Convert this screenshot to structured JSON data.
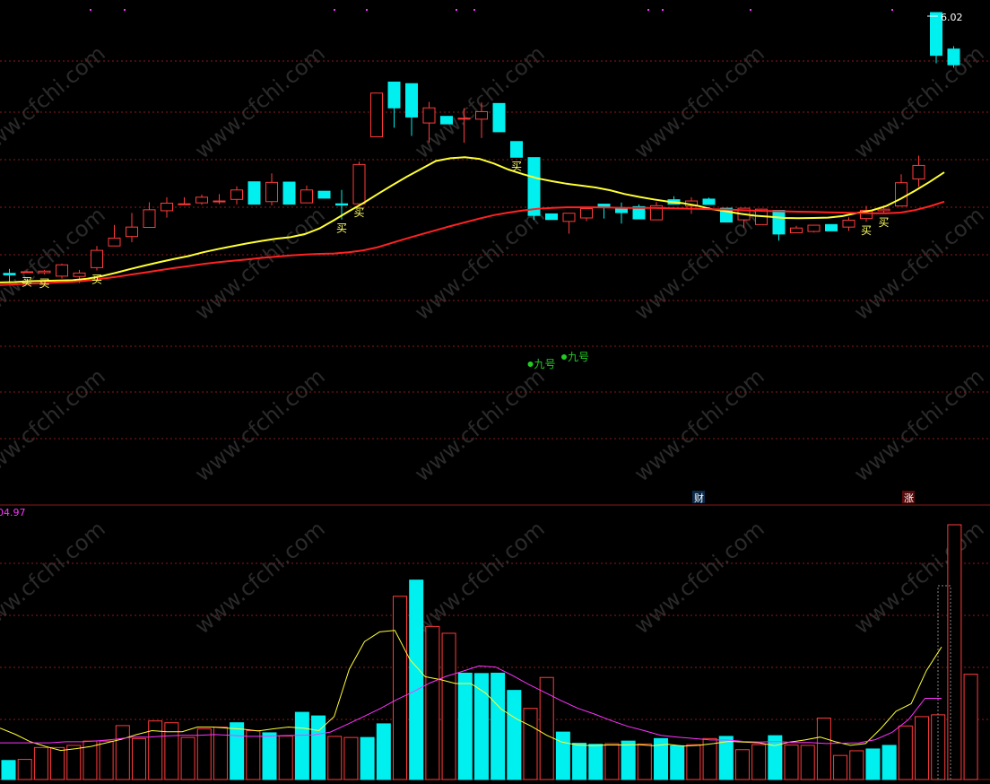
{
  "colors": {
    "background": "#000000",
    "up": "#ff3b3b",
    "down": "#00f0f0",
    "ma_short": "#ffff33",
    "ma_long": "#ff2222",
    "vol_ma_short": "#ffff33",
    "vol_ma_long": "#ff33ff",
    "grid": "#8b1a1a",
    "buy_signal": "#ffff66",
    "nine_signal": "#22cc22",
    "value_label": "#ff33ff",
    "price_label": "#ffffff",
    "watermark": "#2a2a2a"
  },
  "price_panel": {
    "high_price_label": "6.02",
    "buy_label": "买",
    "nine_label": "九号",
    "tags": {
      "cai": "财",
      "zhang": "涨"
    }
  },
  "volume_panel": {
    "max_label": "04.97"
  },
  "watermark": "www.cfchi.com",
  "chart_data": [
    {
      "type": "candlestick",
      "title": "",
      "price_range": [
        0,
        100
      ],
      "candles": [
        {
          "o": 67.1,
          "c": 66.6,
          "h": 68.5,
          "l": 64.0
        },
        {
          "o": 67.6,
          "c": 67.6,
          "h": 68.0,
          "l": 67.2
        },
        {
          "o": 67.3,
          "c": 67.8,
          "h": 68.2,
          "l": 66.8
        },
        {
          "o": 66.2,
          "c": 69.8,
          "h": 70.2,
          "l": 65.4
        },
        {
          "o": 66.1,
          "c": 67.2,
          "h": 68.2,
          "l": 64.0
        },
        {
          "o": 68.9,
          "c": 74.4,
          "h": 75.8,
          "l": 68.0
        },
        {
          "o": 75.8,
          "c": 78.3,
          "h": 82.5,
          "l": 75.8
        },
        {
          "o": 78.8,
          "c": 81.8,
          "h": 86.3,
          "l": 77.0
        },
        {
          "o": 81.7,
          "c": 87.3,
          "h": 89.7,
          "l": 81.7
        },
        {
          "o": 87.0,
          "c": 89.4,
          "h": 91.3,
          "l": 84.8
        },
        {
          "o": 89.2,
          "c": 89.2,
          "h": 91.3,
          "l": 89.2
        },
        {
          "o": 89.5,
          "c": 91.3,
          "h": 92.1,
          "l": 88.9
        },
        {
          "o": 90.1,
          "c": 90.1,
          "h": 92.3,
          "l": 89.1
        },
        {
          "o": 90.6,
          "c": 93.6,
          "h": 94.8,
          "l": 89.0
        },
        {
          "o": 96.2,
          "c": 89.1,
          "h": 96.2,
          "l": 89.1
        },
        {
          "o": 89.9,
          "c": 96.0,
          "h": 98.9,
          "l": 88.7
        },
        {
          "o": 96.1,
          "c": 89.1,
          "h": 96.1,
          "l": 89.1
        },
        {
          "o": 89.5,
          "c": 93.6,
          "h": 95.0,
          "l": 89.4
        },
        {
          "o": 93.2,
          "c": 91.0,
          "h": 93.2,
          "l": 91.0
        },
        {
          "o": 89.2,
          "c": 88.8,
          "h": 93.6,
          "l": 84.2
        },
        {
          "o": 89.2,
          "c": 101.7,
          "h": 102.6,
          "l": 89.2
        },
        {
          "o": 110.5,
          "c": 124.4,
          "h": 124.4,
          "l": 110.4
        },
        {
          "o": 127.9,
          "c": 119.7,
          "h": 127.9,
          "l": 113.4
        },
        {
          "o": 127.4,
          "c": 116.8,
          "h": 127.4,
          "l": 110.8
        },
        {
          "o": 114.9,
          "c": 119.7,
          "h": 121.6,
          "l": 108.6
        },
        {
          "o": 117.0,
          "c": 114.6,
          "h": 117.0,
          "l": 114.6
        },
        {
          "o": 116.4,
          "c": 116.4,
          "h": 119.6,
          "l": 108.6
        },
        {
          "o": 116.1,
          "c": 118.5,
          "h": 121.4,
          "l": 110.1
        },
        {
          "o": 121.1,
          "c": 112.1,
          "h": 121.1,
          "l": 112.1
        },
        {
          "o": 109.0,
          "c": 104.0,
          "h": 109.0,
          "l": 104.0
        },
        {
          "o": 103.9,
          "c": 85.5,
          "h": 103.9,
          "l": 84.1
        },
        {
          "o": 86.0,
          "c": 84.2,
          "h": 86.0,
          "l": 84.2
        },
        {
          "o": 83.6,
          "c": 86.2,
          "h": 86.2,
          "l": 79.7
        },
        {
          "o": 84.7,
          "c": 87.7,
          "h": 87.7,
          "l": 83.7
        },
        {
          "o": 89.1,
          "c": 88.0,
          "h": 89.1,
          "l": 84.5
        },
        {
          "o": 87.7,
          "c": 86.4,
          "h": 89.6,
          "l": 82.9
        },
        {
          "o": 88.3,
          "c": 84.4,
          "h": 89.0,
          "l": 84.4
        },
        {
          "o": 84.1,
          "c": 88.6,
          "h": 89.8,
          "l": 84.1
        },
        {
          "o": 90.5,
          "c": 89.1,
          "h": 91.6,
          "l": 89.1
        },
        {
          "o": 88.5,
          "c": 90.1,
          "h": 91.3,
          "l": 86.0
        },
        {
          "o": 90.7,
          "c": 89.0,
          "h": 91.2,
          "l": 89.0
        },
        {
          "o": 87.8,
          "c": 83.4,
          "h": 87.8,
          "l": 83.4
        },
        {
          "o": 84.1,
          "c": 87.8,
          "h": 87.8,
          "l": 81.6
        },
        {
          "o": 82.6,
          "c": 87.5,
          "h": 87.7,
          "l": 82.6
        },
        {
          "o": 87.1,
          "c": 79.6,
          "h": 87.1,
          "l": 77.5
        },
        {
          "o": 80.0,
          "c": 81.5,
          "h": 82.2,
          "l": 80.0
        },
        {
          "o": 80.4,
          "c": 82.4,
          "h": 82.5,
          "l": 80.1
        },
        {
          "o": 82.6,
          "c": 80.6,
          "h": 82.6,
          "l": 80.6
        },
        {
          "o": 81.8,
          "c": 84.0,
          "h": 84.9,
          "l": 80.6
        },
        {
          "o": 84.5,
          "c": 87.1,
          "h": 88.5,
          "l": 83.5
        },
        {
          "o": 87.0,
          "c": 87.5,
          "h": 88.7,
          "l": 86.1
        },
        {
          "o": 88.5,
          "c": 95.9,
          "h": 98.6,
          "l": 88.5
        },
        {
          "o": 97.1,
          "c": 101.4,
          "h": 104.5,
          "l": 94.6
        },
        {
          "o": 150.0,
          "c": 136.4,
          "h": 150.0,
          "l": 133.9
        },
        {
          "o": 138.4,
          "c": 133.4,
          "h": 139.3,
          "l": 132.5
        }
      ],
      "ma_short": [
        64.2,
        64.3,
        64.6,
        64.7,
        64.8,
        64.9,
        65.4,
        66.2,
        67.3,
        68.5,
        69.6,
        70.7,
        71.7,
        72.6,
        73.8,
        74.8,
        75.7,
        76.6,
        77.4,
        78.1,
        78.6,
        79.6,
        81.4,
        84.0,
        86.8,
        89.4,
        92.3,
        95.1,
        97.8,
        100.3,
        102.8,
        103.7,
        104.0,
        103.5,
        102.0,
        100.1,
        98.6,
        97.3,
        96.4,
        95.6,
        95.0,
        94.4,
        93.5,
        92.3,
        91.4,
        90.6,
        89.9,
        89.4,
        88.6,
        87.5,
        86.8,
        86.0,
        85.4,
        85.1,
        84.7,
        84.6,
        84.7,
        84.8,
        85.3,
        86.3,
        87.1,
        88.5,
        90.8,
        93.4,
        96.2,
        99.2
      ],
      "ma_long": [
        63.4,
        63.6,
        63.8,
        64.0,
        64.2,
        64.4,
        64.8,
        65.4,
        66.0,
        66.7,
        67.4,
        68.1,
        68.8,
        69.4,
        70.1,
        70.6,
        71.1,
        71.5,
        72.0,
        72.4,
        72.8,
        73.1,
        73.3,
        73.4,
        73.8,
        74.4,
        75.4,
        76.8,
        78.2,
        79.5,
        80.8,
        82.1,
        83.3,
        84.5,
        85.6,
        86.4,
        87.1,
        87.6,
        87.9,
        88.1,
        88.1,
        88.1,
        88.0,
        87.9,
        87.9,
        87.9,
        87.8,
        87.7,
        87.6,
        87.5,
        87.4,
        87.2,
        87.0,
        86.9,
        86.8,
        86.7,
        86.6,
        86.5,
        86.4,
        86.3,
        86.2,
        86.2,
        86.4,
        87.2,
        88.4,
        89.9
      ],
      "buy_signals": [
        1,
        2,
        5,
        19,
        20,
        29,
        49,
        50
      ],
      "nine_signals": [
        30,
        31
      ]
    },
    {
      "type": "bar",
      "title": "",
      "max_value_label": "04.97",
      "ylim": [
        0,
        100
      ],
      "volumes": [
        5.3,
        5.6,
        8.9,
        8.9,
        9.5,
        10.7,
        10.7,
        15.0,
        11.4,
        16.3,
        15.8,
        11.7,
        14.1,
        14.6,
        15.8,
        13.6,
        13.0,
        12.1,
        18.7,
        17.7,
        12.0,
        11.7,
        11.7,
        15.5,
        51.0,
        55.5,
        42.6,
        40.7,
        29.6,
        29.5,
        29.6,
        24.8,
        19.8,
        28.4,
        13.2,
        10.1,
        9.8,
        10.0,
        10.7,
        9.9,
        11.4,
        9.4,
        9.7,
        11.4,
        12.0,
        8.3,
        9.7,
        12.2,
        9.6,
        9.5,
        17.1,
        6.7,
        8.0,
        8.5,
        9.5,
        14.9,
        17.5,
        18.0,
        70.9,
        29.3
      ],
      "vol_ma_short": [
        14.3,
        12.6,
        10.5,
        9.2,
        8.1,
        8.6,
        9.2,
        10.2,
        11.2,
        12.5,
        13.6,
        13.3,
        13.3,
        14.6,
        14.6,
        14.3,
        14.0,
        13.5,
        14.1,
        14.6,
        14.3,
        13.6,
        17.5,
        30.7,
        38.4,
        41.1,
        41.5,
        33.3,
        28.6,
        27.8,
        26.7,
        26.7,
        24.0,
        19.6,
        16.9,
        14.8,
        12.3,
        10.4,
        9.6,
        9.4,
        9.6,
        9.6,
        9.7,
        9.4,
        9.8,
        9.3,
        9.5,
        10.0,
        10.6,
        10.4,
        10.2,
        9.4,
        10.4,
        11.0,
        11.8,
        10.5,
        9.5,
        10.0,
        14.2,
        19.0,
        21.1,
        30.3,
        36.9
      ],
      "vol_ma_long": [
        10.2,
        10.2,
        10.2,
        10.2,
        10.5,
        10.5,
        10.8,
        11.2,
        11.8,
        11.8,
        12.1,
        12.3,
        12.3,
        12.5,
        12.3,
        12.0,
        12.0,
        12.2,
        12.3,
        12.4,
        13.2,
        15.3,
        17.5,
        19.7,
        22.2,
        24.4,
        26.8,
        28.7,
        30.1,
        31.6,
        31.3,
        29.0,
        26.5,
        24.2,
        21.9,
        19.8,
        18.2,
        16.4,
        14.8,
        13.6,
        12.3,
        11.8,
        11.4,
        11.0,
        11.0,
        10.6,
        10.4,
        10.6,
        10.3,
        10.3,
        10.0,
        10.1,
        10.2,
        11.1,
        13.1,
        16.7,
        22.6,
        22.6
      ]
    }
  ]
}
